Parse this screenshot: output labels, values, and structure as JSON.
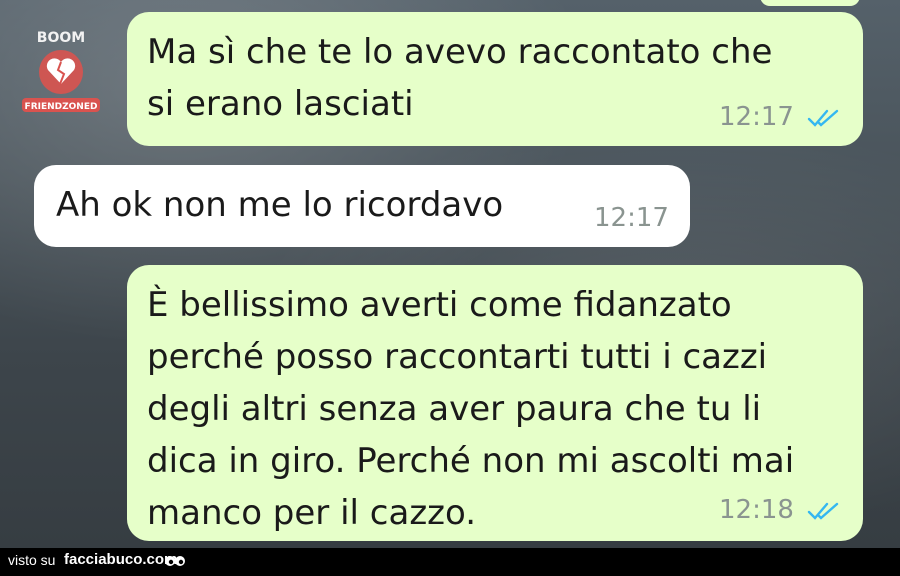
{
  "messages": [
    {
      "id": "m1",
      "direction": "outgoing",
      "text": "Ma sì che te lo avevo raccontato che\nsi erano lasciati",
      "time": "12:17",
      "status": "read"
    },
    {
      "id": "m2",
      "direction": "incoming",
      "text": "Ah ok non me lo ricordavo",
      "time": "12:17"
    },
    {
      "id": "m3",
      "direction": "outgoing",
      "text": "È bellissimo averti come fidanzato\nperché posso raccontarti tutti i cazzi\ndegli altri senza aver paura che tu li\ndica in giro. Perché non mi ascolti mai\nmanco per il cazzo.",
      "time": "12:18",
      "status": "read"
    }
  ],
  "watermark": {
    "top_text": "BOOM",
    "bottom_text": "FRIENDZONED"
  },
  "footer": {
    "prefix": "visto su",
    "brand": "facciabuco.com",
    "icon": "eyes-icon"
  },
  "colors": {
    "outgoing_bubble": "#e6ffc9",
    "incoming_bubble": "#ffffff",
    "read_ticks": "#34b7f1",
    "time": "#8a9490"
  }
}
